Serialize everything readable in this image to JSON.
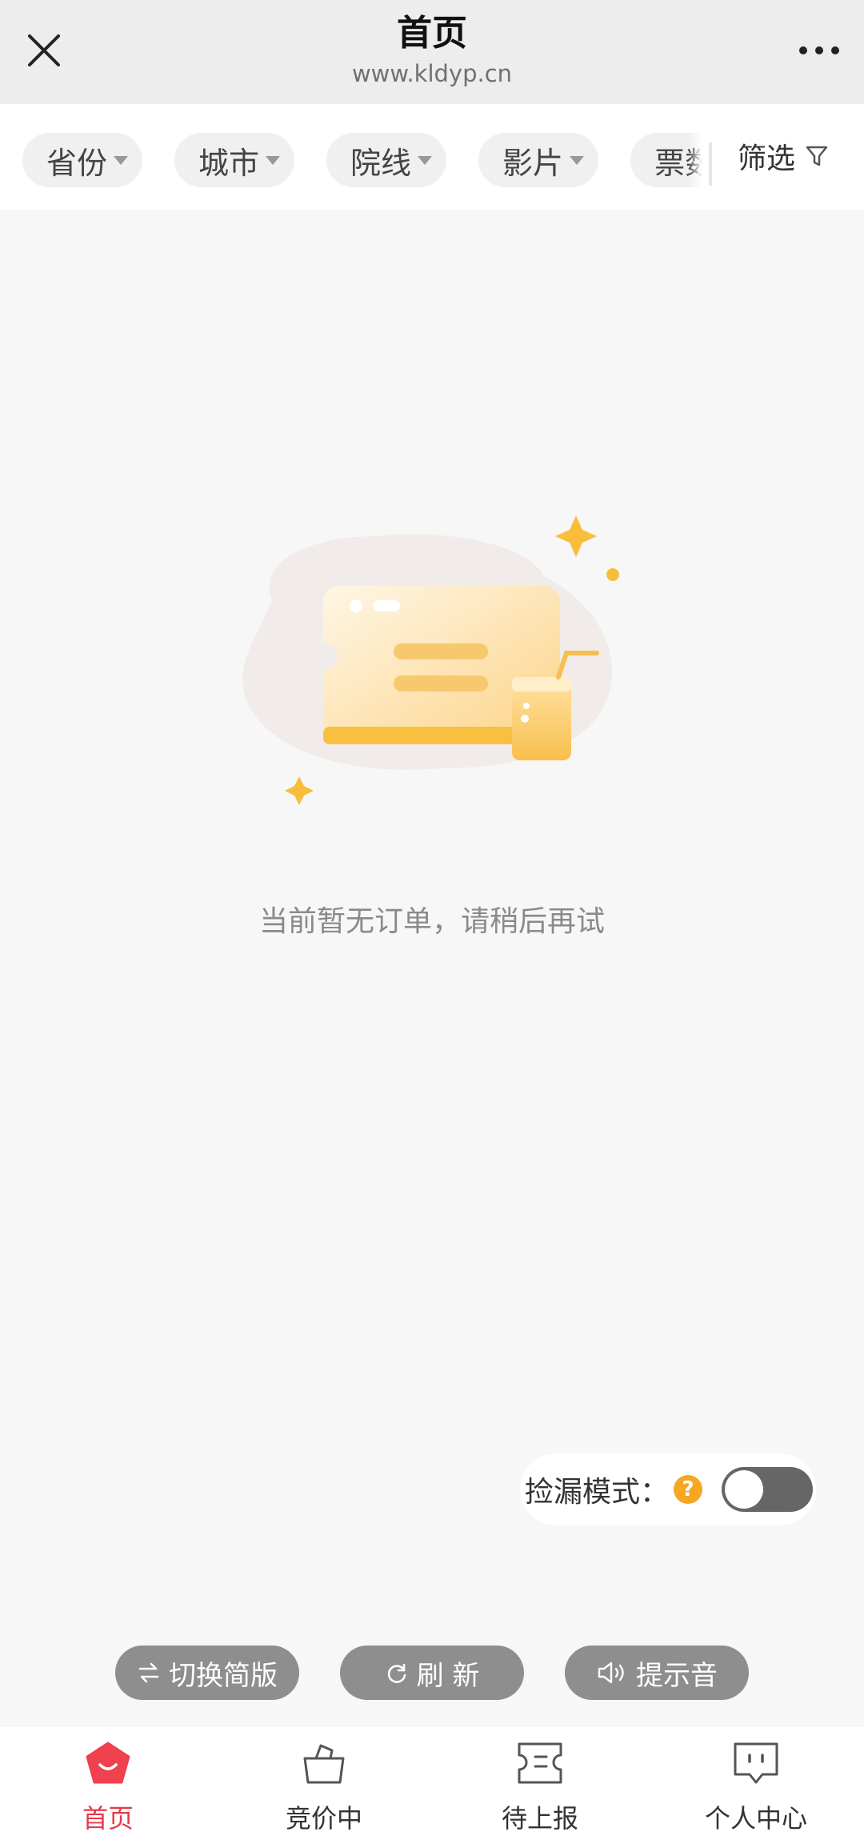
{
  "header": {
    "title": "首页",
    "url": "www.kldyp.cn"
  },
  "filters": {
    "chips": [
      {
        "label": "省份"
      },
      {
        "label": "城市"
      },
      {
        "label": "院线"
      },
      {
        "label": "影片"
      },
      {
        "label": "票数"
      }
    ],
    "filter_label": "筛选"
  },
  "empty_state": {
    "message": "当前暂无订单，请稍后再试"
  },
  "mode": {
    "label": "捡漏模式：",
    "help_symbol": "?",
    "enabled": false
  },
  "actions": {
    "switch_label": "切换简版",
    "refresh_label": "刷 新",
    "sound_label": "提示音"
  },
  "tabs": [
    {
      "label": "首页",
      "icon": "home-icon",
      "active": true
    },
    {
      "label": "竞价中",
      "icon": "shopping-bag-icon",
      "active": false
    },
    {
      "label": "待上报",
      "icon": "ticket-icon",
      "active": false
    },
    {
      "label": "个人中心",
      "icon": "profile-icon",
      "active": false
    }
  ],
  "colors": {
    "accent": "#e6394a",
    "warning": "#f5a623",
    "button_gray": "#8e8e8e"
  }
}
